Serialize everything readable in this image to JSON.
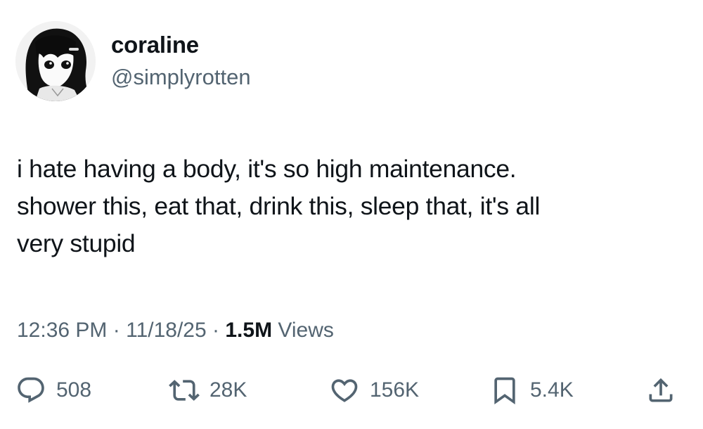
{
  "user": {
    "display_name": "coraline",
    "handle": "@simplyrotten",
    "avatar_icon": "anime-girl-avatar"
  },
  "post": {
    "lines": [
      "i hate having a body, it's so high maintenance.",
      "shower this, eat that, drink this, sleep that, it's all",
      "very stupid"
    ]
  },
  "meta": {
    "time": "12:36 PM",
    "sep1": "·",
    "date": "11/18/25",
    "sep2": "·",
    "views_count": "1.5M",
    "views_label": "Views"
  },
  "actions": {
    "replies": {
      "icon": "reply-icon",
      "count": "508"
    },
    "reposts": {
      "icon": "repost-icon",
      "count": "28K"
    },
    "likes": {
      "icon": "heart-icon",
      "count": "156K"
    },
    "bookmarks": {
      "icon": "bookmark-icon",
      "count": "5.4K"
    },
    "share": {
      "icon": "share-icon"
    }
  },
  "colors": {
    "text_primary": "#0f1419",
    "text_secondary": "#536471",
    "background": "#ffffff"
  }
}
